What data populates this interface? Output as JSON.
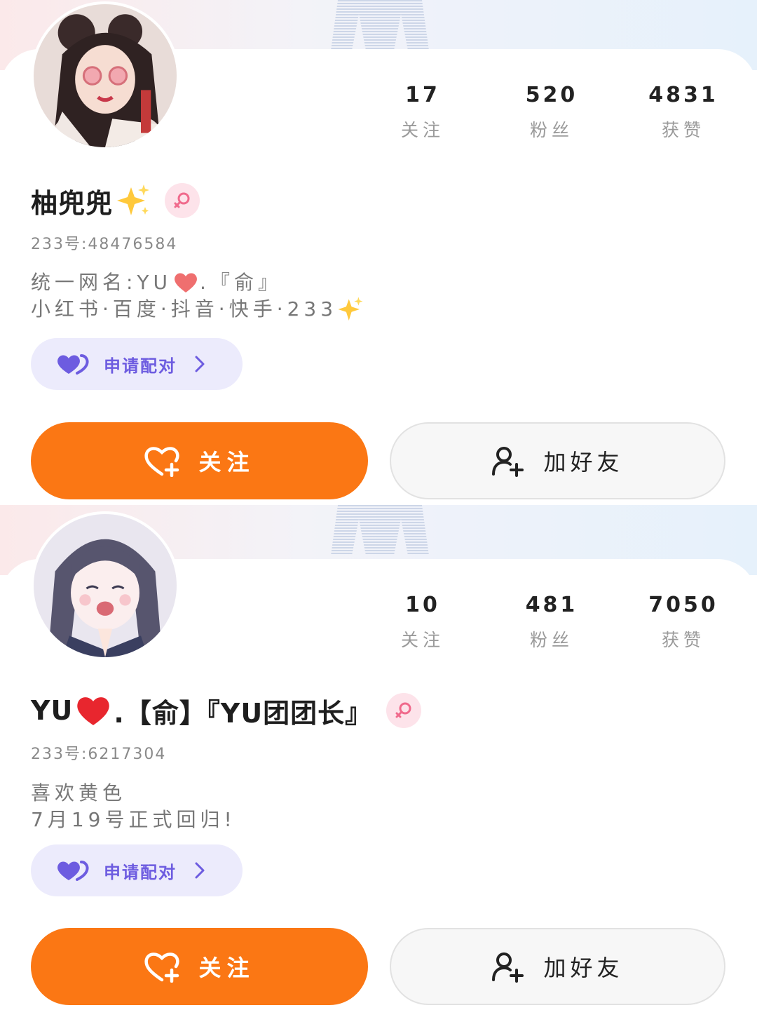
{
  "profiles": [
    {
      "stats": [
        {
          "value": "17",
          "label": "关注"
        },
        {
          "value": "520",
          "label": "粉丝"
        },
        {
          "value": "4831",
          "label": "获赞"
        }
      ],
      "name": "柚兜兜",
      "name_suffix_icon": "sparkles-icon",
      "gender_icon": "female-icon",
      "uid": "233号:48476584",
      "bio_line1_prefix": "统一网名:YU",
      "bio_line1_suffix": ".『俞』",
      "bio_line2": "小红书·百度·抖音·快手·233",
      "pair_button": "申请配对",
      "follow_button": "关注",
      "add_friend_button": "加好友"
    },
    {
      "stats": [
        {
          "value": "10",
          "label": "关注"
        },
        {
          "value": "481",
          "label": "粉丝"
        },
        {
          "value": "7050",
          "label": "获赞"
        }
      ],
      "name_prefix": "YU",
      "name_suffix": ".【俞】『YU团团长』",
      "gender_icon": "female-icon",
      "uid": "233号:6217304",
      "bio_line1": "喜欢黄色",
      "bio_line2": "7月19号正式回归!",
      "pair_button": "申请配对",
      "follow_button": "关注",
      "add_friend_button": "加好友"
    }
  ],
  "colors": {
    "follow_orange": "#fb7714",
    "pair_purple": "#6d5ce0",
    "pair_bg": "#ecebfc",
    "female_pink": "#f06a8c"
  }
}
